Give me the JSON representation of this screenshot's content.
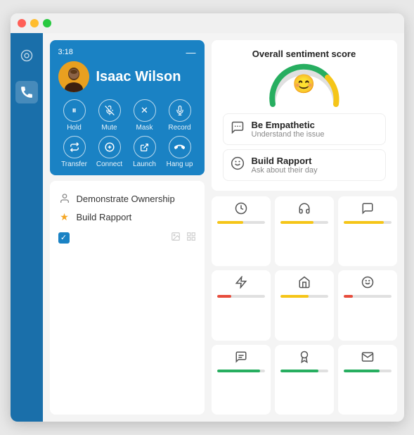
{
  "window": {
    "dots": [
      "red",
      "yellow",
      "green"
    ]
  },
  "sidebar": {
    "items": [
      {
        "icon": "🟠",
        "name": "home",
        "active": false
      },
      {
        "icon": "📞",
        "name": "phone",
        "active": true
      }
    ]
  },
  "call": {
    "timer": "3:18",
    "caller_name": "Isaac Wilson",
    "actions": [
      {
        "label": "Hold",
        "icon": "⏸",
        "name": "hold"
      },
      {
        "label": "Mute",
        "icon": "🎤",
        "name": "mute"
      },
      {
        "label": "Mask",
        "icon": "✕",
        "name": "mask"
      },
      {
        "label": "Record",
        "icon": "⊙",
        "name": "record"
      },
      {
        "label": "Transfer",
        "icon": "⇄",
        "name": "transfer"
      },
      {
        "label": "Connect",
        "icon": "+",
        "name": "connect"
      },
      {
        "label": "Launch",
        "icon": "↗",
        "name": "launch"
      },
      {
        "label": "Hang up",
        "icon": "☎",
        "name": "hangup"
      }
    ]
  },
  "suggestions": {
    "items": [
      {
        "text": "Demonstrate Ownership",
        "type": "person"
      },
      {
        "text": "Build Rapport",
        "type": "star"
      }
    ],
    "footer_icons": [
      "image",
      "grid"
    ]
  },
  "sentiment": {
    "title": "Overall sentiment score",
    "score": 75,
    "face": "😊"
  },
  "behaviors": [
    {
      "icon": "💬",
      "title": "Be Empathetic",
      "subtitle": "Understand the issue",
      "name": "empathetic"
    },
    {
      "icon": "😊",
      "title": "Build Rapport",
      "subtitle": "Ask about their day",
      "name": "rapport"
    }
  ],
  "metrics": [
    {
      "icon": "🕐",
      "name": "time",
      "bar_color": "#f5c518",
      "fill_pct": 55
    },
    {
      "icon": "🎧",
      "name": "headset",
      "bar_color": "#f5c518",
      "fill_pct": 70
    },
    {
      "icon": "💬",
      "name": "chat",
      "bar_color": "#f5c518",
      "fill_pct": 85
    },
    {
      "icon": "⚡",
      "name": "bolt",
      "bar_color": "#e74c3c",
      "fill_pct": 30
    },
    {
      "icon": "🏠",
      "name": "home",
      "bar_color": "#f5c518",
      "fill_pct": 60
    },
    {
      "icon": "😊",
      "name": "smile",
      "bar_color": "#e74c3c",
      "fill_pct": 20
    },
    {
      "icon": "💭",
      "name": "speech",
      "bar_color": "#27ae60",
      "fill_pct": 90
    },
    {
      "icon": "🎓",
      "name": "badge",
      "bar_color": "#27ae60",
      "fill_pct": 80
    },
    {
      "icon": "📧",
      "name": "email",
      "bar_color": "#27ae60",
      "fill_pct": 75
    }
  ],
  "colors": {
    "sidebar_bg": "#1a6faa",
    "call_card_bg": "#1a82c4",
    "gauge_green": "#27ae60",
    "gauge_yellow": "#f5c518",
    "accent_blue": "#1a82c4"
  }
}
